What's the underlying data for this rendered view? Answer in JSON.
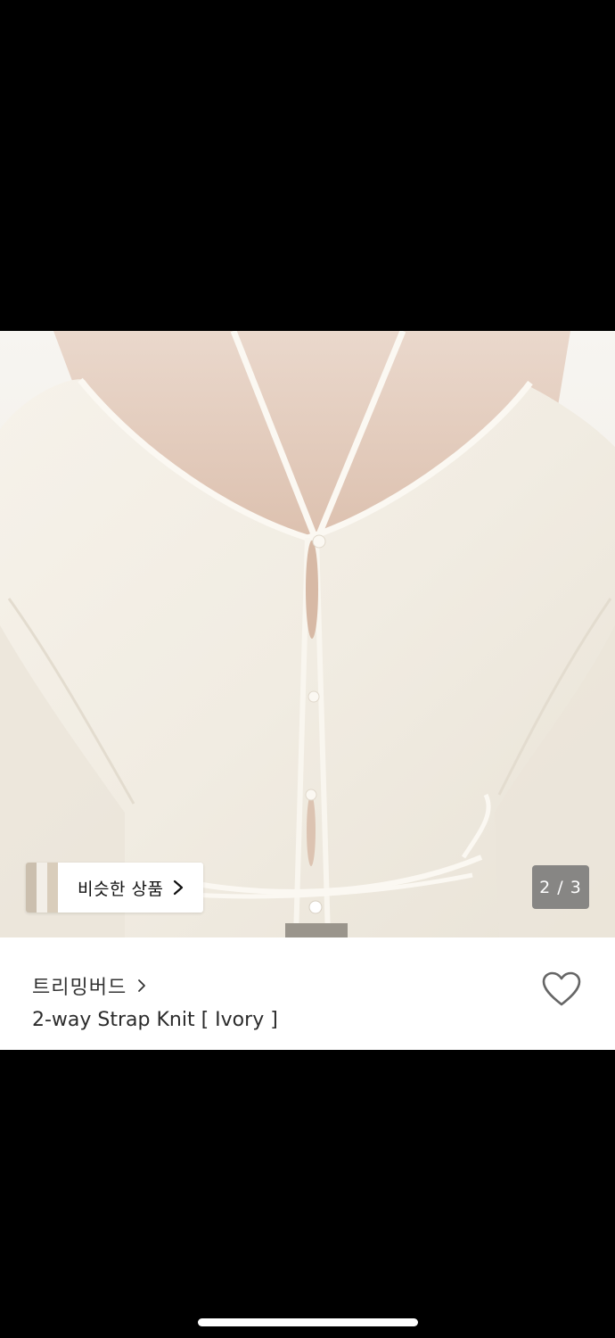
{
  "image": {
    "alt_semantic": "product-photo"
  },
  "similar_products": {
    "label": "비슷한 상품"
  },
  "gallery": {
    "counter": "2 / 3"
  },
  "product": {
    "brand": "트리밍버드",
    "name": "2-way Strap Knit [ Ivory ]"
  },
  "colors": {
    "background": "#000000",
    "panel": "#ffffff",
    "knit": "#f3efe6",
    "counter_bg": "#6e6e6e"
  },
  "icons": {
    "heart": "heart-outline-icon",
    "chevron": "chevron-right-icon"
  }
}
